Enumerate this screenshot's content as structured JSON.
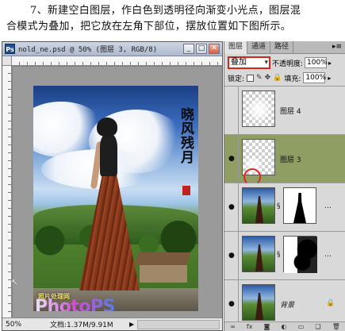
{
  "caption": {
    "line1": "7、新建空白图层，作白色到透明径向渐变小光点，图层混",
    "line2": "合模式为叠加，把它放在左角下部位，摆放位置如下图所示。"
  },
  "document": {
    "title": "nold_ne.psd @ 50% (图层 3, RGB/8)",
    "app_icon": "Ps",
    "buttons": {
      "minimize": "_",
      "maximize": "□",
      "close": "✕"
    },
    "status": {
      "zoom": "50%",
      "info": "文档:1.37M/9.91M",
      "arrow": "▶"
    },
    "image": {
      "calligraphy": "晓风残月",
      "watermark_small": "照片处理网",
      "watermark_logo": "PhotoPS"
    }
  },
  "layers_panel": {
    "tabs": [
      "图层",
      "通道",
      "路径"
    ],
    "active_tab": 0,
    "menu_icon": "▸≡",
    "blend_mode": "叠加",
    "opacity_label": "不透明度:",
    "opacity_value": "100%",
    "lock_label": "锁定:",
    "fill_label": "填充:",
    "fill_value": "100%",
    "layers": [
      {
        "name": "图层 4",
        "visible": false,
        "type": "light",
        "selected": false
      },
      {
        "name": "图层 3",
        "visible": true,
        "type": "light",
        "selected": true
      },
      {
        "name": "",
        "visible": true,
        "type": "photo-mask",
        "selected": false
      },
      {
        "name": "",
        "visible": true,
        "type": "photo-mask-dark",
        "selected": false
      },
      {
        "name": "背景",
        "visible": true,
        "type": "background",
        "selected": false
      }
    ],
    "bottom_icons": [
      "link-icon",
      "fx-icon",
      "mask-icon",
      "adjust-icon",
      "folder-icon",
      "new-layer-icon",
      "trash-icon"
    ],
    "highlight_color": "#e0261d",
    "selected_color": "#8f9e62"
  }
}
